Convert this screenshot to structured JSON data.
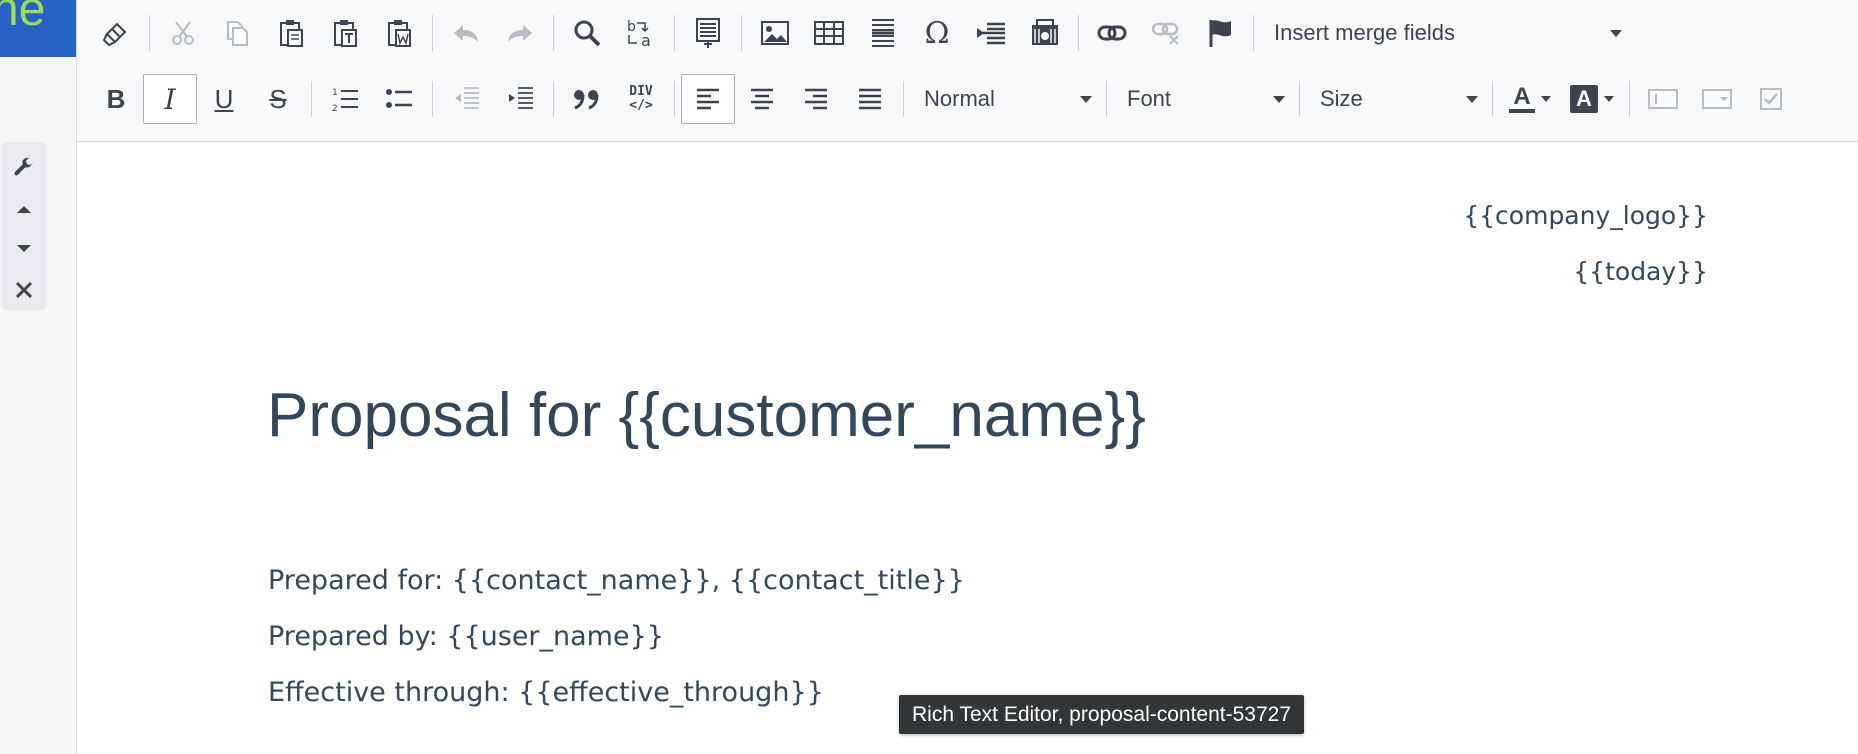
{
  "brand": {
    "text": "ne"
  },
  "side_tools": [
    {
      "icon": "wrench-icon"
    },
    {
      "icon": "caret-up-icon"
    },
    {
      "icon": "caret-down-icon"
    },
    {
      "icon": "close-icon"
    }
  ],
  "toolbar": {
    "merge_fields_label": "Insert merge fields",
    "format_label": "Normal",
    "font_label": "Font",
    "size_label": "Size",
    "bold_label": "B",
    "italic_label": "I",
    "underline_label": "U",
    "strike_label": "S",
    "omega_label": "Ω",
    "div_label_top": "DIV",
    "div_label_bottom": "</>",
    "text_color_label": "A",
    "bg_color_label": "A",
    "accent_color": "#2462c4"
  },
  "document": {
    "company_logo": "{{company_logo}}",
    "today": "{{today}}",
    "title": "Proposal for {{customer_name}}",
    "prepared_for": "Prepared for: {{contact_name}}, {{contact_title}}",
    "prepared_by": "Prepared by: {{user_name}}",
    "effective_through": "Effective through: {{effective_through}}"
  },
  "tooltip": {
    "text": "Rich Text Editor, proposal-content-53727"
  }
}
